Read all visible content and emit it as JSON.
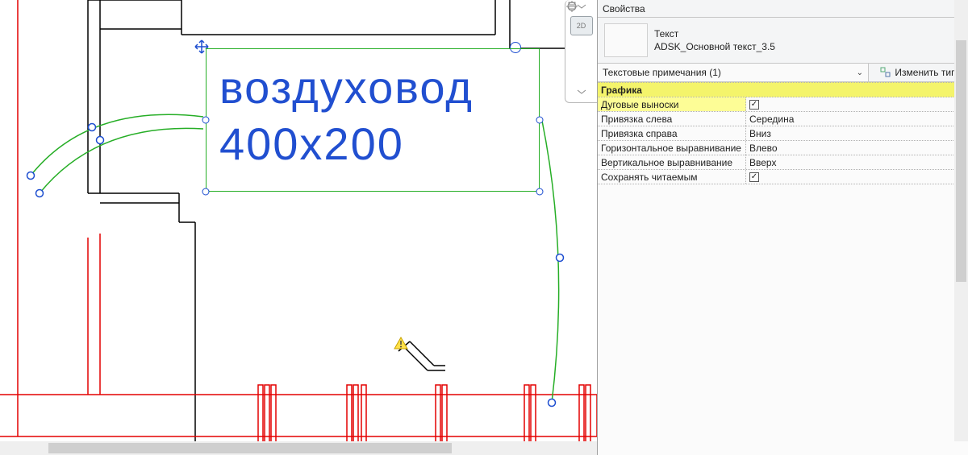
{
  "panel": {
    "title": "Свойства",
    "type_name": "Текст",
    "type_family": "ADSK_Основной текст_3.5",
    "selector": "Текстовые примечания (1)",
    "edit_type": "Изменить тип"
  },
  "section": {
    "graphics": "Графика",
    "collapse_glyph": "»"
  },
  "rows": [
    {
      "name": "Дуговые выноски",
      "value": "",
      "check": true
    },
    {
      "name": "Привязка слева",
      "value": "Середина"
    },
    {
      "name": "Привязка справа",
      "value": "Вниз"
    },
    {
      "name": "Горизонтальное выравнивание",
      "value": "Влево"
    },
    {
      "name": "Вертикальное выравнивание",
      "value": "Вверх"
    },
    {
      "name": "Сохранять читаемым",
      "value": "",
      "check": true
    }
  ],
  "canvas_text": {
    "line1": "воздуховод",
    "line2": "400х200"
  },
  "viewcube": {
    "mode2d": "2D"
  },
  "icons": {
    "check": "✓",
    "chev": "⌄",
    "x": "✕"
  }
}
